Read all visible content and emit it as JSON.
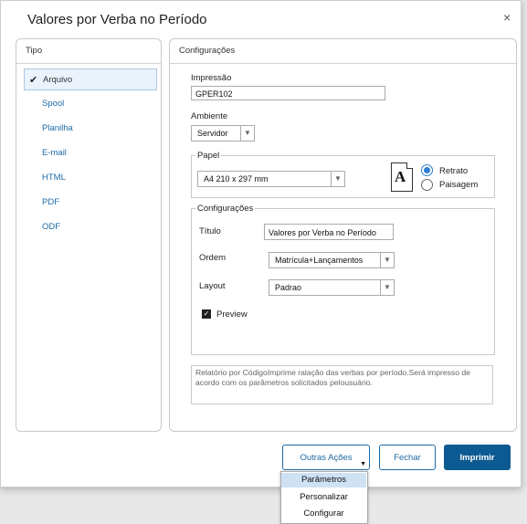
{
  "dialog": {
    "title": "Valores por Verba no Período",
    "close_glyph": "×"
  },
  "tipo": {
    "header": "Tipo",
    "items": [
      {
        "label": "Arquivo",
        "selected": true
      },
      {
        "label": "Spool"
      },
      {
        "label": "Planilha"
      },
      {
        "label": "E-mail"
      },
      {
        "label": "HTML"
      },
      {
        "label": "PDF"
      },
      {
        "label": "ODF"
      }
    ]
  },
  "config": {
    "header": "Configurações",
    "impressao_label": "Impressão",
    "impressao_value": "GPER102",
    "ambiente_label": "Ambiente",
    "ambiente_value": "Servidor",
    "papel": {
      "legend": "Papel",
      "size_value": "A4 210 x 297 mm",
      "orientation_icon": "document-A-icon",
      "icon_letter": "A",
      "retrato_label": "Retrato",
      "paisagem_label": "Paisagem",
      "selected": "Retrato"
    },
    "inner": {
      "legend": "Configurações",
      "titulo_label": "Título",
      "titulo_value": "Valores por Verba no Período",
      "ordem_label": "Ordem",
      "ordem_value": "Matrícula+Lançamentos",
      "layout_label": "Layout",
      "layout_value": "Padrao",
      "preview_label": "Preview",
      "preview_checked": true
    },
    "description": "Relatório por CódigoImprime ralação das verbas por período.Será impresso de acordo com os parâmetros solicitados pelousuário."
  },
  "buttons": {
    "outras_acoes": "Outras Ações",
    "fechar": "Fechar",
    "imprimir": "Imprimir"
  },
  "menu": {
    "items": [
      "Parâmetros",
      "Personalizar",
      "Configurar"
    ],
    "highlighted": "Parâmetros"
  },
  "colors": {
    "accent": "#1c6aa6",
    "primary_button": "#0c5a91",
    "selection_bg": "#eaf2fb",
    "menu_highlight": "#cfe2f4"
  }
}
